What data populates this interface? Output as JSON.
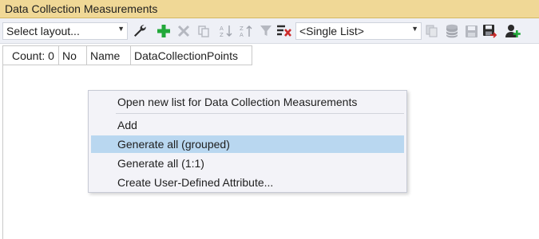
{
  "window": {
    "title": "Data Collection Measurements"
  },
  "toolbar": {
    "layout_combo": {
      "value": "Select layout..."
    },
    "list_mode_combo": {
      "value": "<Single List>"
    },
    "icons": {
      "wrench": "wrench-icon",
      "add": "add-icon",
      "delete": "delete-icon",
      "copy": "copy-icon",
      "sort_asc": "sort-ascending-icon",
      "sort_desc": "sort-descending-icon",
      "filter": "filter-icon",
      "clear_filter": "clear-filter-icon",
      "duplicate": "duplicate-icon",
      "database": "database-icon",
      "save": "save-icon",
      "save_as": "save-as-icon",
      "add_user": "add-user-icon"
    }
  },
  "grid": {
    "count_label": "Count: 0",
    "columns": [
      "No",
      "Name",
      "DataCollectionPoints"
    ]
  },
  "context_menu": {
    "items": [
      {
        "label": "Open new list for Data Collection Measurements",
        "highlighted": false
      },
      {
        "label": "Add",
        "highlighted": false
      },
      {
        "label": "Generate all (grouped)",
        "highlighted": true
      },
      {
        "label": "Generate all (1:1)",
        "highlighted": false
      },
      {
        "label": "Create User-Defined Attribute...",
        "highlighted": false
      }
    ]
  },
  "colors": {
    "title_bar": "#f0d896",
    "toolbar": "#eef0f6",
    "menu_background": "#f3f3f8",
    "menu_highlight": "#b9d7f0",
    "add_green": "#22a83a",
    "clear_red": "#cc2b2b"
  }
}
